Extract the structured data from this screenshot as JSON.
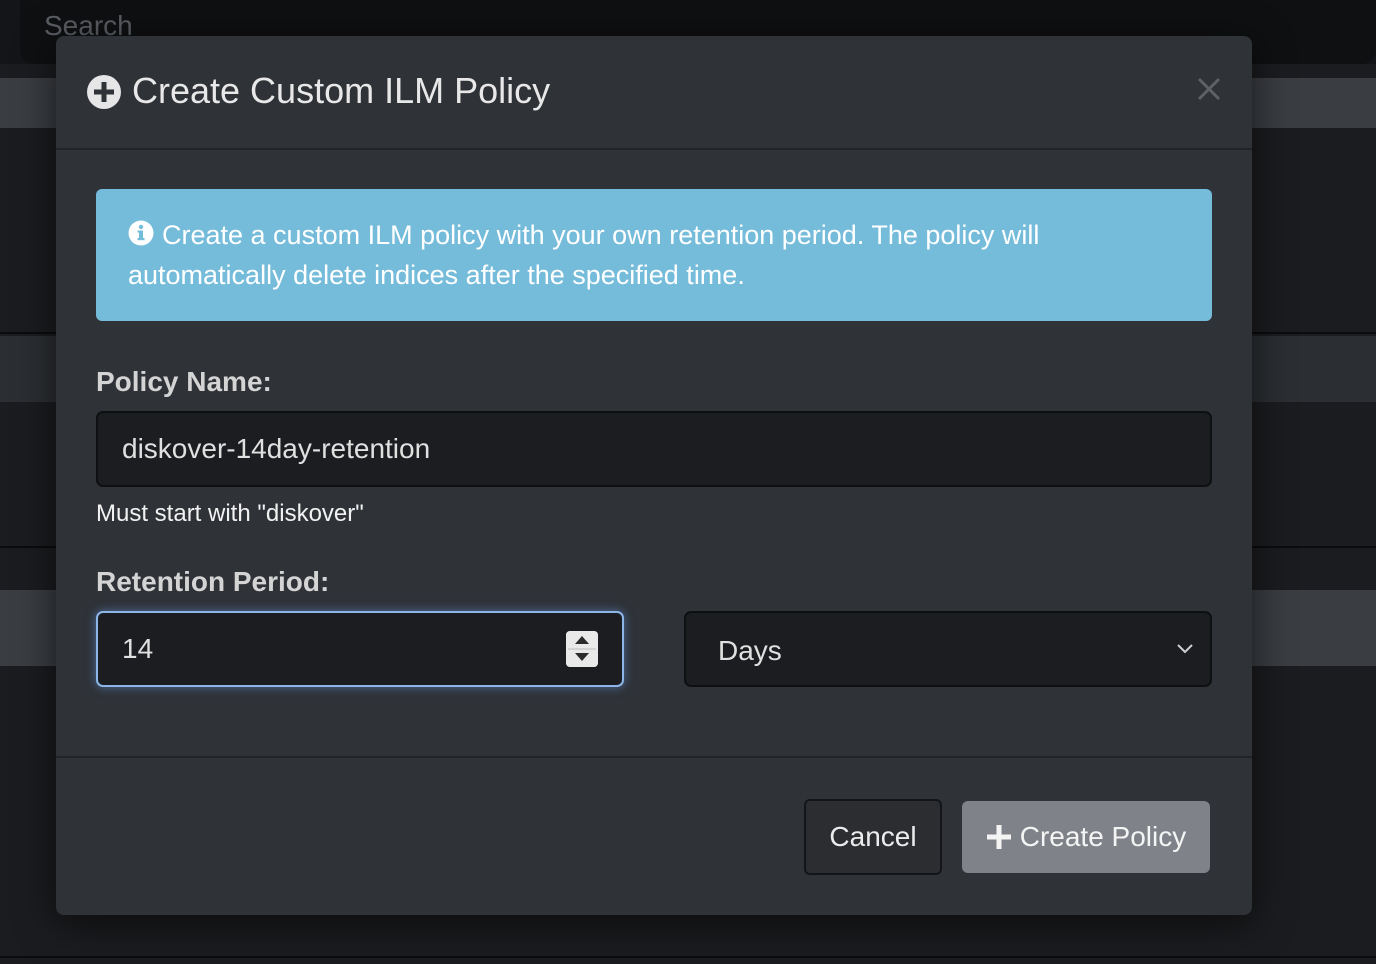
{
  "background": {
    "search_placeholder": "Search"
  },
  "modal": {
    "title": "Create Custom ILM Policy",
    "alert_text": "Create a custom ILM policy with your own retention period. The policy will automatically delete indices after the specified time.",
    "policy_name_label": "Policy Name:",
    "policy_name_value": "diskover-14day-retention",
    "policy_name_help": "Must start with \"diskover\"",
    "retention_label": "Retention Period:",
    "retention_value": "14",
    "retention_unit": "Days",
    "cancel_label": "Cancel",
    "create_label": "Create Policy"
  },
  "colors": {
    "alert_bg": "#75bcdb",
    "modal_bg": "#2f3237",
    "create_button_bg": "#7f8389",
    "focus_border": "#8cb5e8"
  },
  "icons": {
    "header": "plus-circle-icon",
    "close": "close-icon",
    "alert": "info-circle-icon",
    "spinner": "spinner-arrows-icon",
    "select": "chevron-down-icon",
    "create": "plus-icon"
  }
}
